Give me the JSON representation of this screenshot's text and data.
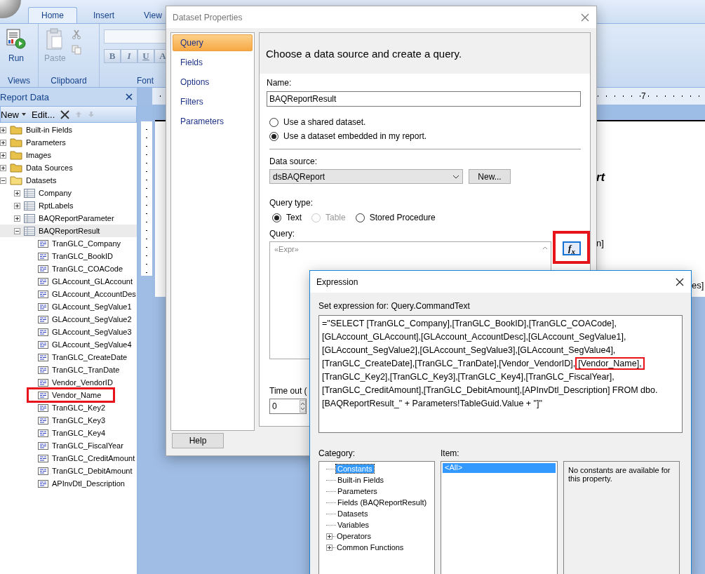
{
  "ribbon": {
    "tabs": [
      {
        "label": "Home",
        "selected": true
      },
      {
        "label": "Insert",
        "selected": false
      },
      {
        "label": "View",
        "selected": false
      }
    ],
    "groups": [
      {
        "kind": "views",
        "label": "Views",
        "button": "Run"
      },
      {
        "kind": "clipboard",
        "label": "Clipboard",
        "button": "Paste"
      },
      {
        "kind": "font",
        "label": "Font",
        "format_buttons": [
          "B",
          "I",
          "U",
          "A"
        ]
      }
    ]
  },
  "report_data": {
    "title": "Report Data",
    "toolbar": {
      "new": "New",
      "edit": "Edit..."
    },
    "tree": [
      {
        "kind": "folder",
        "label": "Built-in Fields",
        "expanded": false,
        "selected": false
      },
      {
        "kind": "folder",
        "label": "Parameters",
        "expanded": false,
        "selected": false
      },
      {
        "kind": "folder",
        "label": "Images",
        "expanded": false,
        "selected": false
      },
      {
        "kind": "folder",
        "label": "Data Sources",
        "expanded": false,
        "selected": false
      },
      {
        "kind": "folder",
        "label": "Datasets",
        "expanded": true,
        "selected": false,
        "children": [
          {
            "kind": "dataset",
            "label": "Company",
            "expanded": false,
            "selected": false
          },
          {
            "kind": "dataset",
            "label": "RptLabels",
            "expanded": false,
            "selected": false
          },
          {
            "kind": "dataset",
            "label": "BAQReportParameter",
            "expanded": false,
            "selected": false
          },
          {
            "kind": "dataset",
            "label": "BAQReportResult",
            "expanded": true,
            "selected": true,
            "children": [
              {
                "kind": "field",
                "label": "TranGLC_Company",
                "selected": false,
                "highlighted": false
              },
              {
                "kind": "field",
                "label": "TranGLC_BookID",
                "selected": false,
                "highlighted": false
              },
              {
                "kind": "field",
                "label": "TranGLC_COACode",
                "selected": false,
                "highlighted": false
              },
              {
                "kind": "field",
                "label": "GLAccount_GLAccount",
                "selected": false,
                "highlighted": false
              },
              {
                "kind": "field",
                "label": "GLAccount_AccountDes",
                "selected": false,
                "highlighted": false
              },
              {
                "kind": "field",
                "label": "GLAccount_SegValue1",
                "selected": false,
                "highlighted": false
              },
              {
                "kind": "field",
                "label": "GLAccount_SegValue2",
                "selected": false,
                "highlighted": false
              },
              {
                "kind": "field",
                "label": "GLAccount_SegValue3",
                "selected": false,
                "highlighted": false
              },
              {
                "kind": "field",
                "label": "GLAccount_SegValue4",
                "selected": false,
                "highlighted": false
              },
              {
                "kind": "field",
                "label": "TranGLC_CreateDate",
                "selected": false,
                "highlighted": false
              },
              {
                "kind": "field",
                "label": "TranGLC_TranDate",
                "selected": false,
                "highlighted": false
              },
              {
                "kind": "field",
                "label": "Vendor_VendorID",
                "selected": false,
                "highlighted": false
              },
              {
                "kind": "field",
                "label": "Vendor_Name",
                "selected": false,
                "highlighted": true
              },
              {
                "kind": "field",
                "label": "TranGLC_Key2",
                "selected": false,
                "highlighted": false
              },
              {
                "kind": "field",
                "label": "TranGLC_Key3",
                "selected": false,
                "highlighted": false
              },
              {
                "kind": "field",
                "label": "TranGLC_Key4",
                "selected": false,
                "highlighted": false
              },
              {
                "kind": "field",
                "label": "TranGLC_FiscalYear",
                "selected": false,
                "highlighted": false
              },
              {
                "kind": "field",
                "label": "TranGLC_CreditAmount",
                "selected": false,
                "highlighted": false
              },
              {
                "kind": "field",
                "label": "TranGLC_DebitAmount",
                "selected": false,
                "highlighted": false
              },
              {
                "kind": "field",
                "label": "APInvDtl_Description",
                "selected": false,
                "highlighted": false
              }
            ]
          }
        ]
      }
    ]
  },
  "design_surface": {
    "ruler_label": "7",
    "fragments": [
      "rt",
      "n]",
      "es]"
    ]
  },
  "dataset_dialog": {
    "title": "Dataset Properties",
    "nav": [
      {
        "label": "Query",
        "selected": true
      },
      {
        "label": "Fields",
        "selected": false
      },
      {
        "label": "Options",
        "selected": false
      },
      {
        "label": "Filters",
        "selected": false
      },
      {
        "label": "Parameters",
        "selected": false
      }
    ],
    "help_button": "Help",
    "heading": "Choose a data source and create a query.",
    "name_label": "Name:",
    "name_value": "BAQReportResult",
    "dataset_options": [
      {
        "label": "Use a shared dataset.",
        "selected": false
      },
      {
        "label": "Use a dataset embedded in my report.",
        "selected": true
      }
    ],
    "data_source_label": "Data source:",
    "data_source_value": "dsBAQReport",
    "new_button": "New...",
    "query_type_label": "Query type:",
    "query_types": [
      {
        "label": "Text",
        "selected": true,
        "disabled": false
      },
      {
        "label": "Table",
        "selected": false,
        "disabled": true
      },
      {
        "label": "Stored Procedure",
        "selected": false,
        "disabled": false
      }
    ],
    "query_label": "Query:",
    "query_placeholder": "«Expr»",
    "fx_button": "f$_{x}$",
    "timeout_label": "Time out (",
    "timeout_value": "0"
  },
  "expression_dialog": {
    "title": "Expression",
    "set_label": "Set expression for: Query.CommandText",
    "expression": [
      {
        "text": "=\"SELECT [TranGLC_Company],[TranGLC_BookID],[TranGLC_COACode],\n[GLAccount_GLAccount],[GLAccount_AccountDesc],[GLAccount_SegValue1],\n[GLAccount_SegValue2],[GLAccount_SegValue3],[GLAccount_SegValue4],\n[TranGLC_CreateDate],[TranGLC_TranDate],[Vendor_VendorID],",
        "highlighted": false
      },
      {
        "text": "[Vendor_Name],",
        "highlighted": true
      },
      {
        "text": "\n[TranGLC_Key2],[TranGLC_Key3],[TranGLC_Key4],[TranGLC_FiscalYear],\n[TranGLC_CreditAmount],[TranGLC_DebitAmount],[APInvDtl_Description] FROM dbo.\n[BAQReportResult_\" + Parameters!TableGuid.Value + \"]\"",
        "highlighted": false
      }
    ],
    "category_label": "Category:",
    "categories": [
      {
        "kind": "leaf",
        "label": "Constants",
        "selected": true
      },
      {
        "kind": "leaf",
        "label": "Built-in Fields",
        "selected": false
      },
      {
        "kind": "leaf",
        "label": "Parameters",
        "selected": false
      },
      {
        "kind": "leaf",
        "label": "Fields (BAQReportResult)",
        "selected": false
      },
      {
        "kind": "leaf",
        "label": "Datasets",
        "selected": false
      },
      {
        "kind": "leaf",
        "label": "Variables",
        "selected": false
      },
      {
        "kind": "group",
        "label": "Operators",
        "selected": false,
        "expanded": false
      },
      {
        "kind": "group",
        "label": "Common Functions",
        "selected": false,
        "expanded": false
      }
    ],
    "item_label": "Item:",
    "items": [
      {
        "label": "<All>",
        "selected": true
      }
    ],
    "description": "No constants are available for this property."
  }
}
